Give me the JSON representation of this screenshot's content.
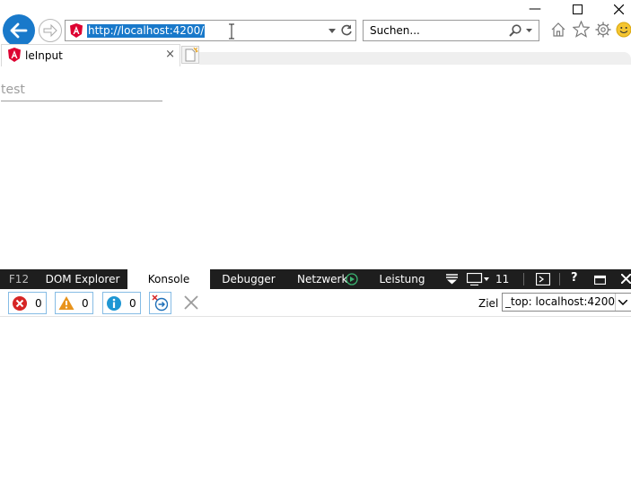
{
  "window": {
    "minimize_glyph": "—",
    "maximize_glyph": "☐",
    "close_glyph": "✕"
  },
  "navigation": {
    "url": "http://localhost:4200/",
    "search_placeholder": "Suchen..."
  },
  "tab": {
    "title": "leInput",
    "close_glyph": "×"
  },
  "page": {
    "input_value": "test"
  },
  "devtools": {
    "tabs": [
      {
        "label": "F12"
      },
      {
        "label": "DOM Explorer"
      },
      {
        "label": "Konsole"
      },
      {
        "label": "Debugger"
      },
      {
        "label": "Netzwerk"
      },
      {
        "label": "Leistung"
      }
    ],
    "emulation_count": "11",
    "help_glyph": "?",
    "errors": "0",
    "warnings": "0",
    "messages": "0",
    "target_label": "Ziel",
    "target_value": "_top: localhost:4200"
  },
  "colors": {
    "accent": "#1979ca",
    "devtools_bar": "#1e1e1e",
    "error": "#d62525",
    "warning": "#e8931c",
    "info": "#1e96d3"
  }
}
